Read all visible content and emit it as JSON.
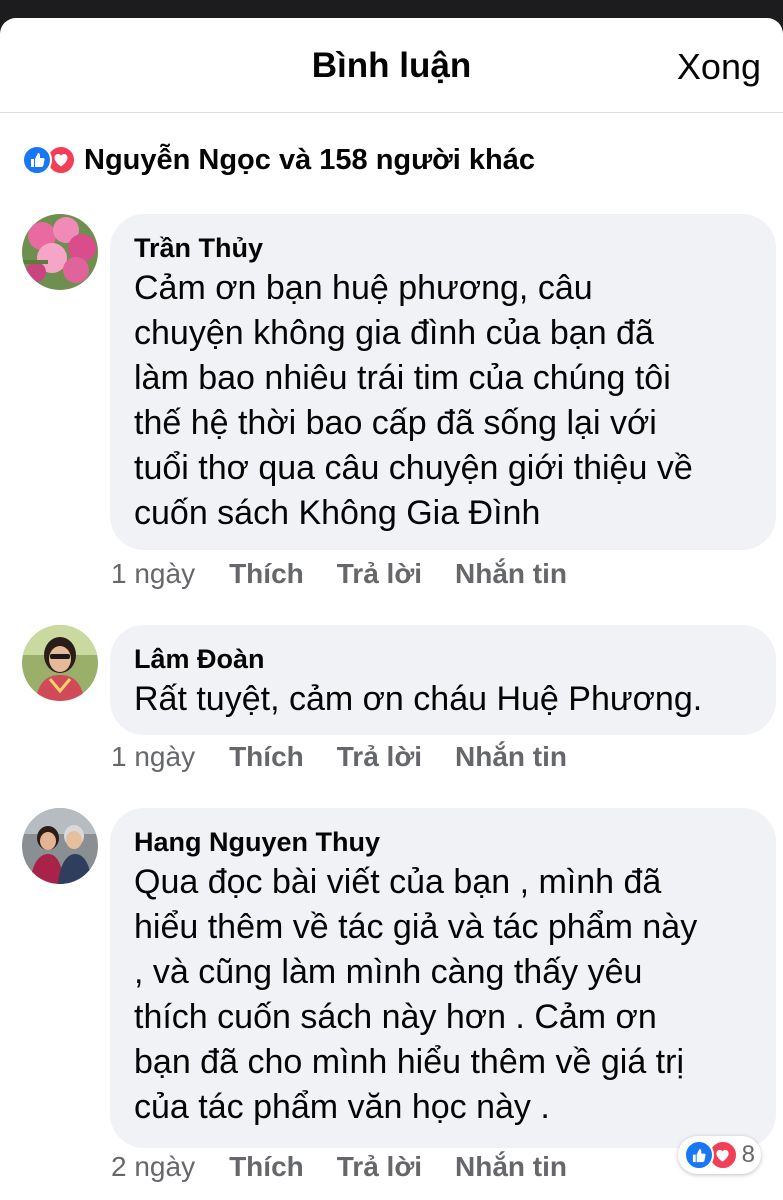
{
  "header": {
    "title": "Bình luận",
    "done_label": "Xong"
  },
  "reactions": {
    "summary": "Nguyễn Ngọc và 158 người khác",
    "icons": [
      "like-icon",
      "love-icon"
    ],
    "like_color": "#1877f2",
    "love_color": "#f33e58"
  },
  "comments": [
    {
      "author": "Trần Thủy",
      "text": "Cảm ơn bạn huệ phương, câu\nchuyện không gia đình của bạn đã\nlàm bao nhiêu trái tim của chúng tôi\nthế hệ thời bao cấp đã sống lại với\ntuổi thơ qua câu chuyện giới thiệu về\ncuốn sách Không Gia Đình",
      "time": "1 ngày",
      "like": "Thích",
      "reply": "Trả lời",
      "message": "Nhắn tin"
    },
    {
      "author": "Lâm Đoàn",
      "text": "Rất tuyệt, cảm ơn cháu Huệ Phương.",
      "time": "1 ngày",
      "like": "Thích",
      "reply": "Trả lời",
      "message": "Nhắn tin"
    },
    {
      "author": "Hang Nguyen Thuy",
      "text": "Qua đọc bài viết của bạn , mình đã\nhiểu thêm về tác giả và tác phẩm này\n, và cũng làm  mình càng thấy yêu\nthích cuốn sách này hơn . Cảm ơn\nbạn đã cho mình hiểu thêm về giá trị\ncủa tác phẩm văn học này .",
      "time": "2 ngày",
      "like": "Thích",
      "reply": "Trả lời",
      "message": "Nhắn tin",
      "reaction_count": "8"
    }
  ]
}
